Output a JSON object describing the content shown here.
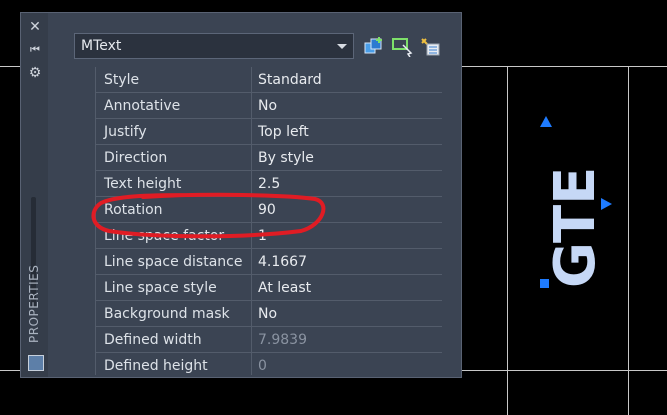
{
  "palette": {
    "title": "PROPERTIES",
    "object_type": "MText",
    "rows": [
      {
        "name": "Style",
        "value": "Standard"
      },
      {
        "name": "Annotative",
        "value": "No"
      },
      {
        "name": "Justify",
        "value": "Top left"
      },
      {
        "name": "Direction",
        "value": "By style"
      },
      {
        "name": "Text height",
        "value": "2.5"
      },
      {
        "name": "Rotation",
        "value": "90"
      },
      {
        "name": "Line space factor",
        "value": "1"
      },
      {
        "name": "Line space distance",
        "value": "4.1667"
      },
      {
        "name": "Line space style",
        "value": "At least"
      },
      {
        "name": "Background mask",
        "value": "No"
      },
      {
        "name": "Defined width",
        "value": "7.9839"
      },
      {
        "name": "Defined height",
        "value": "0"
      }
    ]
  },
  "drawing": {
    "mtext_content": "GTE"
  },
  "colors": {
    "highlight": "#e01c24",
    "grip": "#1e7bff",
    "text": "#c6d8f6"
  }
}
